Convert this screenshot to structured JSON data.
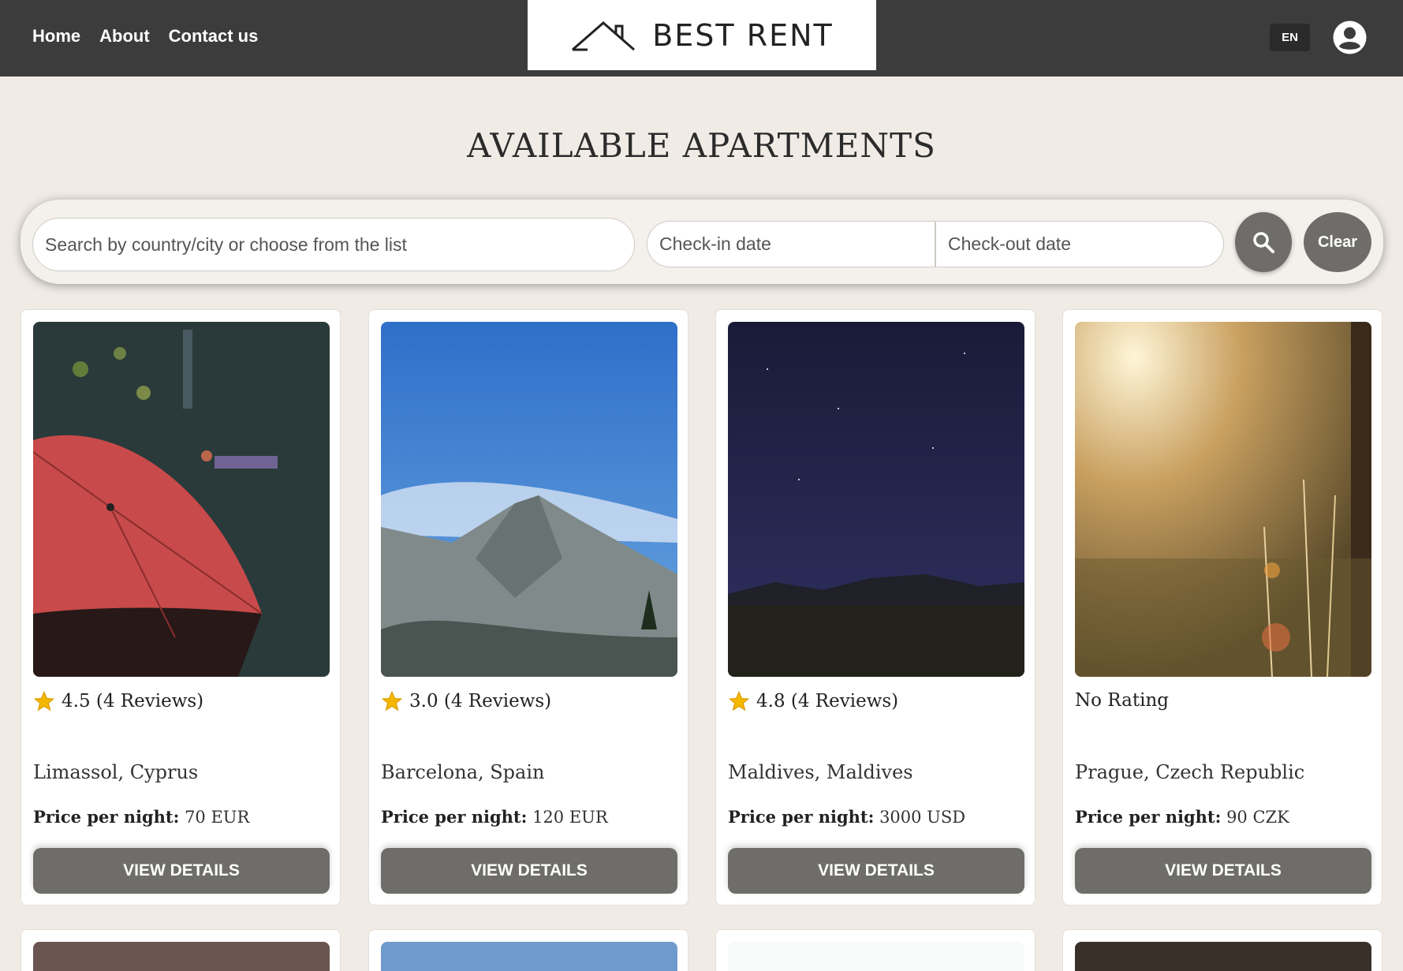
{
  "nav": {
    "home": "Home",
    "about": "About",
    "contact": "Contact us"
  },
  "logo": {
    "text": "BEST RENT"
  },
  "header": {
    "lang": "EN"
  },
  "page": {
    "title": "AVAILABLE APARTMENTS"
  },
  "search": {
    "placeholder": "Search by country/city or choose from the list",
    "checkin_placeholder": "Check-in date",
    "checkout_placeholder": "Check-out date",
    "clear_label": "Clear"
  },
  "cards": [
    {
      "rating": "4.5 (4 Reviews)",
      "location": "Limassol, Cyprus",
      "price_label": "Price per night:",
      "price": "70 EUR",
      "button": "VIEW DETAILS"
    },
    {
      "rating": "3.0 (4 Reviews)",
      "location": "Barcelona, Spain",
      "price_label": "Price per night:",
      "price": "120 EUR",
      "button": "VIEW DETAILS"
    },
    {
      "rating": "4.8 (4 Reviews)",
      "location": "Maldives, Maldives",
      "price_label": "Price per night:",
      "price": "3000 USD",
      "button": "VIEW DETAILS"
    },
    {
      "rating": "No Rating",
      "location": "Prague, Czech Republic",
      "price_label": "Price per night:",
      "price": "90 CZK",
      "button": "VIEW DETAILS"
    }
  ],
  "colors": {
    "header_bg": "#3c3c3c",
    "page_bg": "#f0ebe5",
    "button_bg": "#6e6d69",
    "star": "#f5b800"
  },
  "icons": {
    "search": "search-icon",
    "account": "account-icon",
    "star": "star-icon",
    "house": "house-icon"
  }
}
